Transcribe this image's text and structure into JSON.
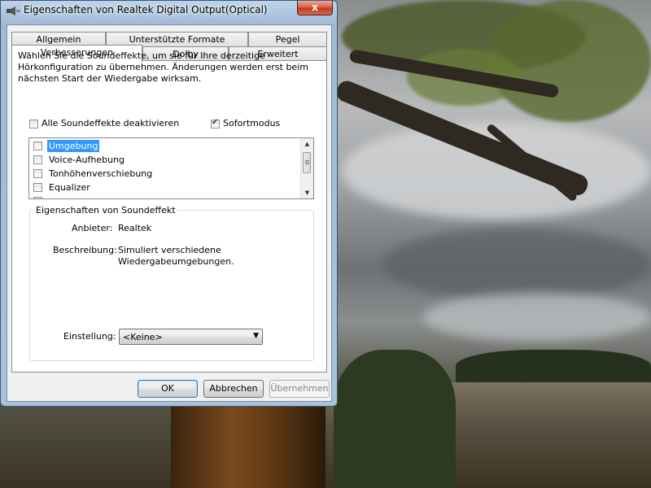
{
  "window": {
    "title": "Eigenschaften von Realtek Digital Output(Optical)",
    "close_label": "x"
  },
  "tabs": {
    "row1": [
      "Allgemein",
      "Unterstützte Formate",
      "Pegel"
    ],
    "row2": [
      "Verbesserungen",
      "Dolby",
      "Erweitert"
    ],
    "active": "Verbesserungen"
  },
  "description": "Wählen Sie die Soundeffekte, um sie für Ihre derzeitige Hörkonfiguration zu übernehmen. Änderungen werden erst beim nächsten Start der Wiedergabe wirksam.",
  "checkboxes": {
    "disable_all": {
      "label": "Alle Soundeffekte deaktivieren",
      "checked": false
    },
    "instant_mode": {
      "label": "Sofortmodus",
      "checked": true
    }
  },
  "effects_list": [
    {
      "label": "Umgebung",
      "checked": false,
      "selected": true
    },
    {
      "label": "Voice-Aufhebung",
      "checked": false,
      "selected": false
    },
    {
      "label": "Tonhöhenverschiebung",
      "checked": false,
      "selected": false
    },
    {
      "label": "Equalizer",
      "checked": false,
      "selected": false
    }
  ],
  "properties": {
    "group_title": "Eigenschaften von Soundeffekt",
    "provider_label": "Anbieter:",
    "provider_value": "Realtek",
    "description_label": "Beschreibung:",
    "description_value": "Simuliert verschiedene Wiedergabeumgebungen.",
    "setting_label": "Einstellung:",
    "setting_value": "<Keine>"
  },
  "buttons": {
    "ok": "OK",
    "cancel": "Abbrechen",
    "apply": "Übernehmen"
  }
}
